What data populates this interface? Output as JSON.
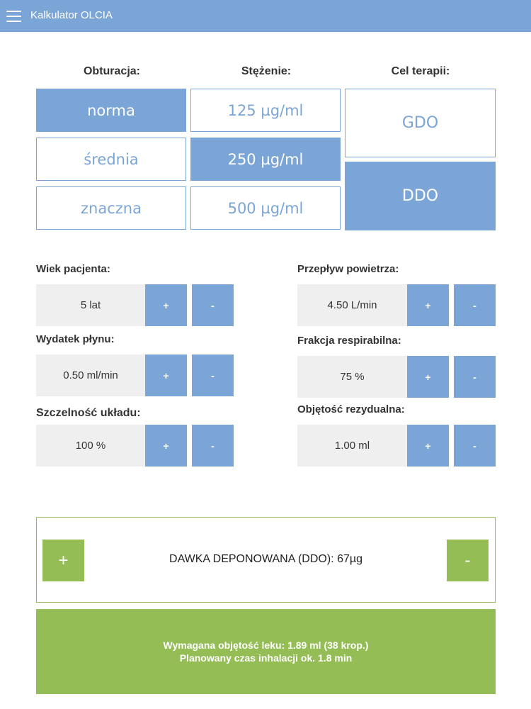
{
  "app_title": "Kalkulator OLCIA",
  "columns": {
    "obturacja": {
      "header": "Obturacja:",
      "options": [
        "norma",
        "średnia",
        "znaczna"
      ],
      "selected": "norma"
    },
    "stezenie": {
      "header": "Stężenie:",
      "options": [
        "125 µg/ml",
        "250 µg/ml",
        "500 µg/ml"
      ],
      "selected": "250 µg/ml"
    },
    "cel": {
      "header": "Cel terapii:",
      "options": [
        "GDO",
        "DDO"
      ],
      "selected": "DDO"
    }
  },
  "params": {
    "wiek": {
      "label": "Wiek pacjenta:",
      "value": "5 lat"
    },
    "wydatek": {
      "label": "Wydatek płynu:",
      "value": "0.50 ml/min"
    },
    "szczelnosc": {
      "label": "Szczelność układu:",
      "value": "100 %"
    },
    "przeplyw": {
      "label": "Przepływ powietrza:",
      "value": "4.50 L/min"
    },
    "frakcja": {
      "label": "Frakcja respirabilna:",
      "value": "75 %"
    },
    "objetosc": {
      "label": "Objętość rezydualna:",
      "value": "1.00 ml"
    }
  },
  "stepper": {
    "plus": "+",
    "minus": "-"
  },
  "dose": {
    "text": "DAWKA DEPONOWANA (DDO): 67µg",
    "plus": "+",
    "minus": "-"
  },
  "result": {
    "line1": "Wymagana objętość leku: 1.89 ml (38 krop.)",
    "line2": "Planowany czas inhalacji ok. 1.8 min"
  },
  "colors": {
    "accent_blue": "#7ca5d7",
    "accent_green": "#95bd55",
    "field_bg": "#efeff0"
  }
}
